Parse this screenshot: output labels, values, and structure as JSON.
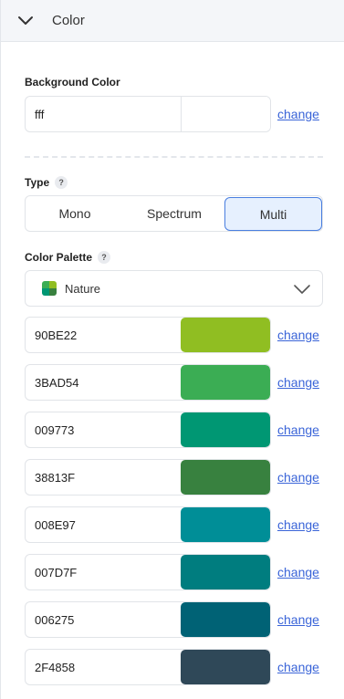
{
  "section": {
    "title": "Color"
  },
  "background": {
    "label": "Background Color",
    "value": "fff",
    "change_label": "change"
  },
  "type": {
    "label": "Type",
    "help": "?",
    "options": [
      "Mono",
      "Spectrum",
      "Multi"
    ],
    "selected": "Multi"
  },
  "palette": {
    "label": "Color Palette",
    "help": "?",
    "selected": "Nature",
    "icon_colors": [
      "#3BAD54",
      "#90BE22",
      "#009773",
      "#38813F"
    ]
  },
  "colors": [
    {
      "hex": "90BE22",
      "color": "#90BE22",
      "change_label": "change"
    },
    {
      "hex": "3BAD54",
      "color": "#3BAD54",
      "change_label": "change"
    },
    {
      "hex": "009773",
      "color": "#009773",
      "change_label": "change"
    },
    {
      "hex": "38813F",
      "color": "#38813F",
      "change_label": "change"
    },
    {
      "hex": "008E97",
      "color": "#008E97",
      "change_label": "change"
    },
    {
      "hex": "007D7F",
      "color": "#007D7F",
      "change_label": "change"
    },
    {
      "hex": "006275",
      "color": "#006275",
      "change_label": "change"
    },
    {
      "hex": "2F4858",
      "color": "#2F4858",
      "change_label": "change"
    }
  ]
}
